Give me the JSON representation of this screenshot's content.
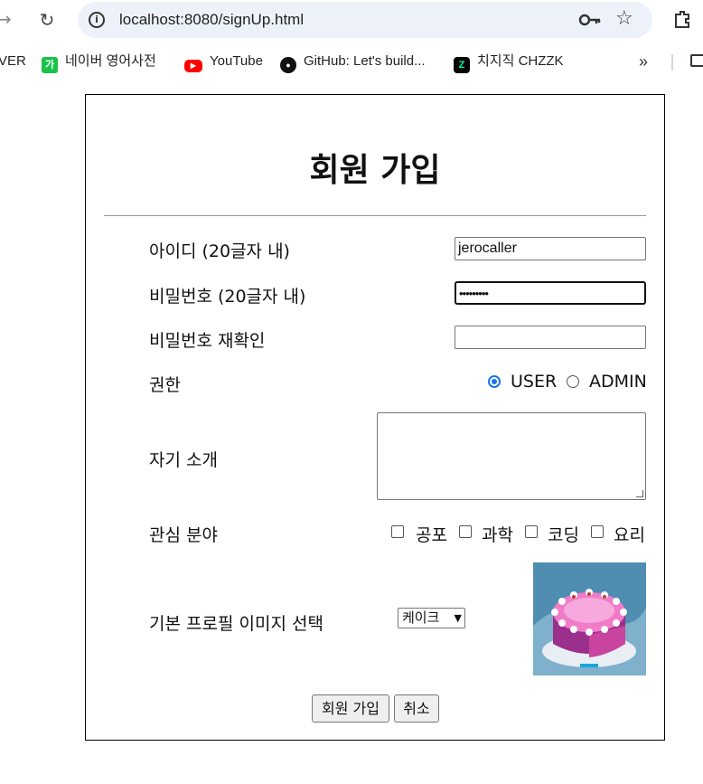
{
  "browser": {
    "url": "localhost:8080/signUp.html",
    "bookmarks": [
      {
        "label": "VER",
        "icon": "naver-partial"
      },
      {
        "label": "네이버 영어사전",
        "icon": "naver-dict-icon",
        "color": "#19c34a",
        "glyph": "가"
      },
      {
        "label": "YouTube",
        "icon": "youtube-icon",
        "color": "#ff0000",
        "glyph": "▶"
      },
      {
        "label": "GitHub: Let's build...",
        "icon": "github-icon",
        "color": "#111111",
        "glyph": "●"
      },
      {
        "label": "치지직 CHZZK",
        "icon": "chzzk-icon",
        "color": "#000000",
        "glyph": "Z"
      }
    ],
    "more_label": "»"
  },
  "form": {
    "title": "회원 가입",
    "fields": {
      "id_label": "아이디 (20글자 내)",
      "id_value": "jerocaller",
      "pw_label": "비밀번호 (20글자 내)",
      "pw_value": "•••••••••",
      "pw_confirm_label": "비밀번호 재확인",
      "pw_confirm_value": "",
      "role_label": "권한",
      "role_options": [
        "USER",
        "ADMIN"
      ],
      "role_selected": "USER",
      "intro_label": "자기 소개",
      "interest_label": "관심 분야",
      "interests": [
        "공포",
        "과학",
        "코딩",
        "요리"
      ],
      "profile_label": "기본 프로필 이미지 선택",
      "profile_selected": "케이크"
    },
    "buttons": {
      "submit": "회원 가입",
      "cancel": "취소"
    }
  },
  "colors": {
    "accent": "#1a73e8",
    "omnibox": "#edf2fa"
  }
}
